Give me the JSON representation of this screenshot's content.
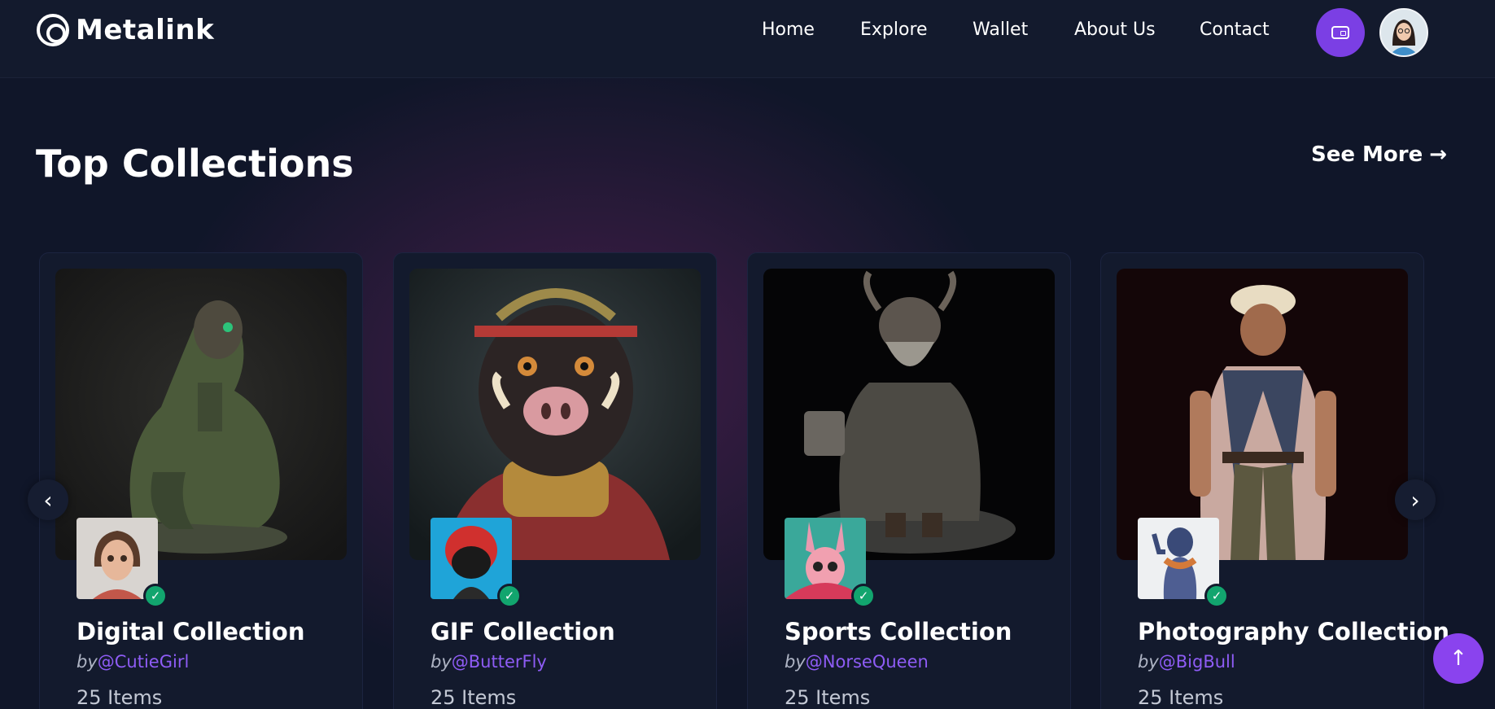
{
  "brand": {
    "name": "Metalink"
  },
  "nav": {
    "items": [
      {
        "label": "Home"
      },
      {
        "label": "Explore"
      },
      {
        "label": "Wallet"
      },
      {
        "label": "About Us"
      },
      {
        "label": "Contact"
      }
    ]
  },
  "header_icons": {
    "wallet": "wallet-icon",
    "avatar": "user-avatar"
  },
  "section": {
    "title": "Top Collections",
    "see_more": "See More",
    "see_more_icon": "arrow-right-icon"
  },
  "collections": [
    {
      "title": "Digital Collection",
      "by": "by",
      "handle": "@CutieGirl",
      "items": "25 Items"
    },
    {
      "title": "GIF Collection",
      "by": "by",
      "handle": "@ButterFly",
      "items": "25 Items"
    },
    {
      "title": "Sports Collection",
      "by": "by",
      "handle": "@NorseQueen",
      "items": "25 Items"
    },
    {
      "title": "Photography Collection",
      "by": "by",
      "handle": "@BigBull",
      "items": "25 Items"
    }
  ],
  "colors": {
    "accent": "#7b3fe4",
    "verified": "#12a56e",
    "handle": "#8e5cf5",
    "background": "#101629"
  },
  "controls": {
    "prev": "chevron-left-icon",
    "next": "chevron-right-icon",
    "scroll_top": "arrow-up-icon"
  }
}
